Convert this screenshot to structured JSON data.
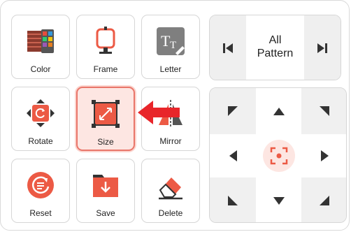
{
  "tools": [
    {
      "label": "Color"
    },
    {
      "label": "Frame"
    },
    {
      "label": "Letter"
    },
    {
      "label": "Rotate"
    },
    {
      "label": "Size",
      "selected": true
    },
    {
      "label": "Mirror"
    },
    {
      "label": "Reset"
    },
    {
      "label": "Save"
    },
    {
      "label": "Delete"
    }
  ],
  "pattern_selector": {
    "label_line1": "All",
    "label_line2": "Pattern",
    "prev_icon": "skip-previous-icon",
    "next_icon": "skip-next-icon"
  },
  "dpad": {
    "center_icon": "center-focus-icon"
  },
  "colors": {
    "accent": "#ec5a45",
    "accent_light": "#fde6e2",
    "arrow": "#e8252a",
    "icon_dark": "#333333"
  }
}
